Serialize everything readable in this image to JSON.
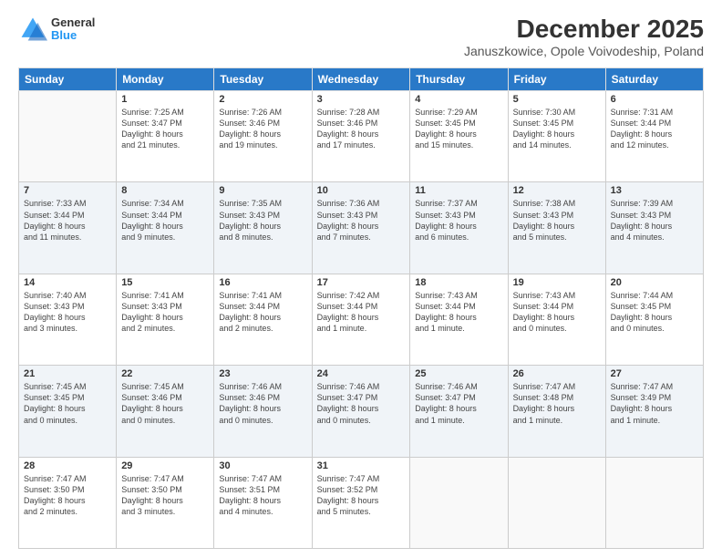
{
  "logo": {
    "general": "General",
    "blue": "Blue"
  },
  "title": "December 2025",
  "subtitle": "Januszkowice, Opole Voivodeship, Poland",
  "days_of_week": [
    "Sunday",
    "Monday",
    "Tuesday",
    "Wednesday",
    "Thursday",
    "Friday",
    "Saturday"
  ],
  "weeks": [
    [
      {
        "day": "",
        "info": ""
      },
      {
        "day": "1",
        "info": "Sunrise: 7:25 AM\nSunset: 3:47 PM\nDaylight: 8 hours\nand 21 minutes."
      },
      {
        "day": "2",
        "info": "Sunrise: 7:26 AM\nSunset: 3:46 PM\nDaylight: 8 hours\nand 19 minutes."
      },
      {
        "day": "3",
        "info": "Sunrise: 7:28 AM\nSunset: 3:46 PM\nDaylight: 8 hours\nand 17 minutes."
      },
      {
        "day": "4",
        "info": "Sunrise: 7:29 AM\nSunset: 3:45 PM\nDaylight: 8 hours\nand 15 minutes."
      },
      {
        "day": "5",
        "info": "Sunrise: 7:30 AM\nSunset: 3:45 PM\nDaylight: 8 hours\nand 14 minutes."
      },
      {
        "day": "6",
        "info": "Sunrise: 7:31 AM\nSunset: 3:44 PM\nDaylight: 8 hours\nand 12 minutes."
      }
    ],
    [
      {
        "day": "7",
        "info": "Sunrise: 7:33 AM\nSunset: 3:44 PM\nDaylight: 8 hours\nand 11 minutes."
      },
      {
        "day": "8",
        "info": "Sunrise: 7:34 AM\nSunset: 3:44 PM\nDaylight: 8 hours\nand 9 minutes."
      },
      {
        "day": "9",
        "info": "Sunrise: 7:35 AM\nSunset: 3:43 PM\nDaylight: 8 hours\nand 8 minutes."
      },
      {
        "day": "10",
        "info": "Sunrise: 7:36 AM\nSunset: 3:43 PM\nDaylight: 8 hours\nand 7 minutes."
      },
      {
        "day": "11",
        "info": "Sunrise: 7:37 AM\nSunset: 3:43 PM\nDaylight: 8 hours\nand 6 minutes."
      },
      {
        "day": "12",
        "info": "Sunrise: 7:38 AM\nSunset: 3:43 PM\nDaylight: 8 hours\nand 5 minutes."
      },
      {
        "day": "13",
        "info": "Sunrise: 7:39 AM\nSunset: 3:43 PM\nDaylight: 8 hours\nand 4 minutes."
      }
    ],
    [
      {
        "day": "14",
        "info": "Sunrise: 7:40 AM\nSunset: 3:43 PM\nDaylight: 8 hours\nand 3 minutes."
      },
      {
        "day": "15",
        "info": "Sunrise: 7:41 AM\nSunset: 3:43 PM\nDaylight: 8 hours\nand 2 minutes."
      },
      {
        "day": "16",
        "info": "Sunrise: 7:41 AM\nSunset: 3:44 PM\nDaylight: 8 hours\nand 2 minutes."
      },
      {
        "day": "17",
        "info": "Sunrise: 7:42 AM\nSunset: 3:44 PM\nDaylight: 8 hours\nand 1 minute."
      },
      {
        "day": "18",
        "info": "Sunrise: 7:43 AM\nSunset: 3:44 PM\nDaylight: 8 hours\nand 1 minute."
      },
      {
        "day": "19",
        "info": "Sunrise: 7:43 AM\nSunset: 3:44 PM\nDaylight: 8 hours\nand 0 minutes."
      },
      {
        "day": "20",
        "info": "Sunrise: 7:44 AM\nSunset: 3:45 PM\nDaylight: 8 hours\nand 0 minutes."
      }
    ],
    [
      {
        "day": "21",
        "info": "Sunrise: 7:45 AM\nSunset: 3:45 PM\nDaylight: 8 hours\nand 0 minutes."
      },
      {
        "day": "22",
        "info": "Sunrise: 7:45 AM\nSunset: 3:46 PM\nDaylight: 8 hours\nand 0 minutes."
      },
      {
        "day": "23",
        "info": "Sunrise: 7:46 AM\nSunset: 3:46 PM\nDaylight: 8 hours\nand 0 minutes."
      },
      {
        "day": "24",
        "info": "Sunrise: 7:46 AM\nSunset: 3:47 PM\nDaylight: 8 hours\nand 0 minutes."
      },
      {
        "day": "25",
        "info": "Sunrise: 7:46 AM\nSunset: 3:47 PM\nDaylight: 8 hours\nand 1 minute."
      },
      {
        "day": "26",
        "info": "Sunrise: 7:47 AM\nSunset: 3:48 PM\nDaylight: 8 hours\nand 1 minute."
      },
      {
        "day": "27",
        "info": "Sunrise: 7:47 AM\nSunset: 3:49 PM\nDaylight: 8 hours\nand 1 minute."
      }
    ],
    [
      {
        "day": "28",
        "info": "Sunrise: 7:47 AM\nSunset: 3:50 PM\nDaylight: 8 hours\nand 2 minutes."
      },
      {
        "day": "29",
        "info": "Sunrise: 7:47 AM\nSunset: 3:50 PM\nDaylight: 8 hours\nand 3 minutes."
      },
      {
        "day": "30",
        "info": "Sunrise: 7:47 AM\nSunset: 3:51 PM\nDaylight: 8 hours\nand 4 minutes."
      },
      {
        "day": "31",
        "info": "Sunrise: 7:47 AM\nSunset: 3:52 PM\nDaylight: 8 hours\nand 5 minutes."
      },
      {
        "day": "",
        "info": ""
      },
      {
        "day": "",
        "info": ""
      },
      {
        "day": "",
        "info": ""
      }
    ]
  ]
}
